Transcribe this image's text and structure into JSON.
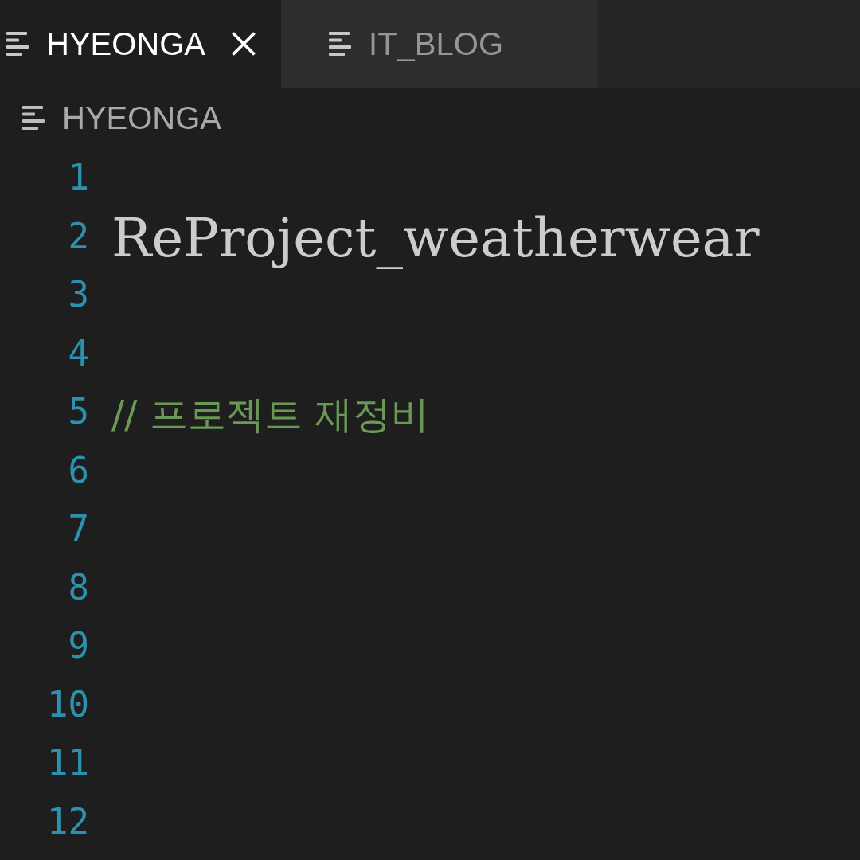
{
  "tabs": [
    {
      "label": "HYEONGA",
      "selected": true
    },
    {
      "label": "IT_BLOG",
      "selected": false
    }
  ],
  "breadcrumb": {
    "label": "HYEONGA"
  },
  "editor": {
    "lines": [
      {
        "number": "1",
        "kind": "blank"
      },
      {
        "number": "2",
        "kind": "heading",
        "text": "ReProject_weatherwear"
      },
      {
        "number": "3",
        "kind": "blank"
      },
      {
        "number": "4",
        "kind": "blank"
      },
      {
        "number": "5",
        "kind": "comment",
        "text": "// 프로젝트 재정비"
      },
      {
        "number": "6",
        "kind": "blank"
      },
      {
        "number": "7",
        "kind": "blank"
      },
      {
        "number": "8",
        "kind": "blank"
      },
      {
        "number": "9",
        "kind": "blank"
      },
      {
        "number": "10",
        "kind": "blank"
      },
      {
        "number": "11",
        "kind": "blank"
      },
      {
        "number": "12",
        "kind": "blank"
      }
    ]
  }
}
